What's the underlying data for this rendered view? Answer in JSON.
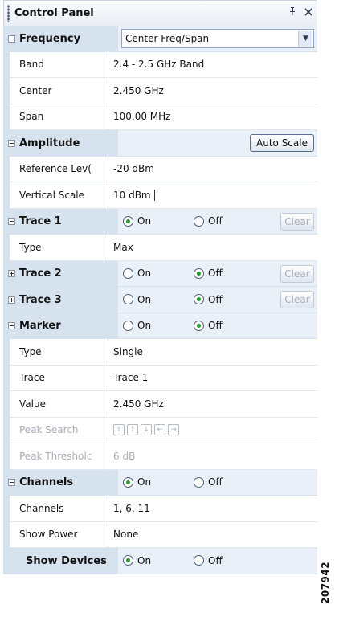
{
  "panel": {
    "title": "Control Panel",
    "pin_icon": "pin-icon",
    "close_icon": "close-icon"
  },
  "frequency": {
    "label": "Frequency",
    "mode": "Center Freq/Span",
    "band_label": "Band",
    "band_value": "2.4 - 2.5 GHz Band",
    "center_label": "Center",
    "center_value": "2.450 GHz",
    "span_label": "Span",
    "span_value": "100.00 MHz"
  },
  "amplitude": {
    "label": "Amplitude",
    "auto_scale": "Auto Scale",
    "reference_label": "Reference Lev(",
    "reference_value": "-20 dBm",
    "vertical_label": "Vertical Scale",
    "vertical_value": "10 dBm"
  },
  "trace1": {
    "label": "Trace 1",
    "on": "On",
    "off": "Off",
    "clear": "Clear",
    "state": "on",
    "type_label": "Type",
    "type_value": "Max"
  },
  "trace2": {
    "label": "Trace 2",
    "on": "On",
    "off": "Off",
    "clear": "Clear",
    "state": "off"
  },
  "trace3": {
    "label": "Trace 3",
    "on": "On",
    "off": "Off",
    "clear": "Clear",
    "state": "off"
  },
  "marker": {
    "label": "Marker",
    "on": "On",
    "off": "Off",
    "state": "off",
    "type_label": "Type",
    "type_value": "Single",
    "trace_label": "Trace",
    "trace_value": "Trace 1",
    "value_label": "Value",
    "value_value": "2.450 GHz",
    "peak_search_label": "Peak Search",
    "peak_threshold_label": "Peak Thresholc",
    "peak_threshold_value": "6 dB"
  },
  "channels": {
    "label": "Channels",
    "on": "On",
    "off": "Off",
    "state": "on",
    "channels_label": "Channels",
    "channels_value": "1, 6, 11",
    "show_power_label": "Show Power",
    "show_power_value": "None"
  },
  "show_devices": {
    "label": "Show Devices",
    "on": "On",
    "off": "Off",
    "state": "on"
  },
  "figure_id": "207942"
}
